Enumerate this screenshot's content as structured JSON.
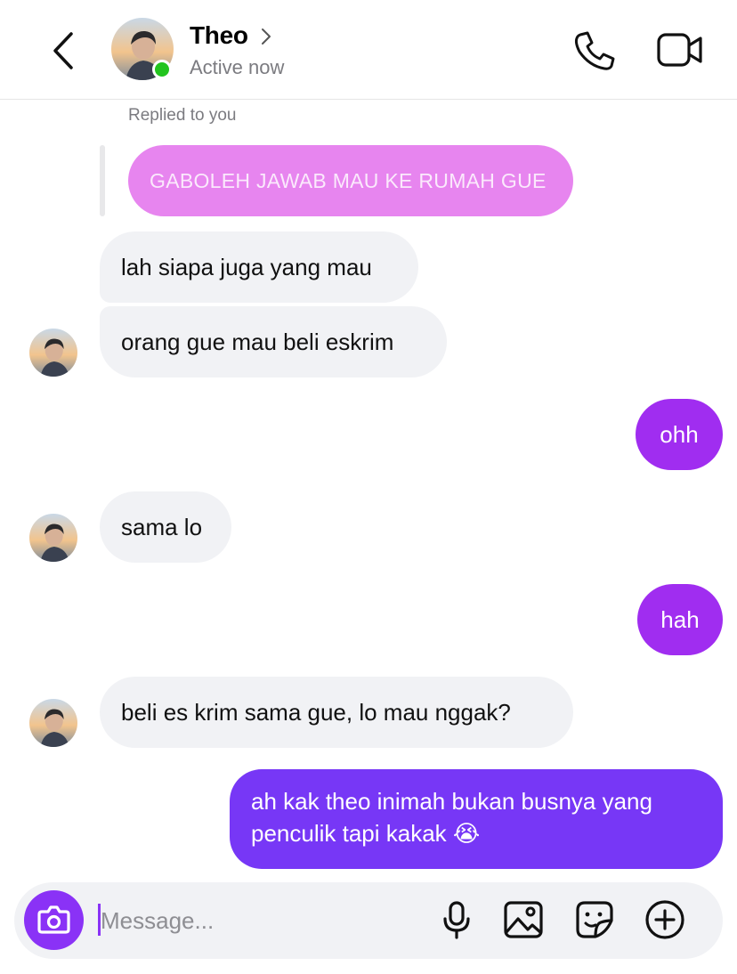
{
  "header": {
    "contact_name": "Theo",
    "status": "Active now"
  },
  "thread": {
    "replied_label": "Replied to you",
    "reply_quote": "GABOLEH JAWAB MAU KE RUMAH GUE",
    "messages": [
      {
        "from": "them",
        "text": "lah siapa juga yang mau"
      },
      {
        "from": "them",
        "text": "orang gue mau beli eskrim"
      },
      {
        "from": "me",
        "text": "ohh"
      },
      {
        "from": "them",
        "text": "sama lo"
      },
      {
        "from": "me",
        "text": "hah"
      },
      {
        "from": "them",
        "text": "beli es krim sama gue, lo mau nggak?"
      },
      {
        "from": "me",
        "text": "ah kak theo inimah bukan busnya yang penculik tapi kakak",
        "emoji": "😭"
      }
    ]
  },
  "composer": {
    "placeholder": "Message..."
  },
  "colors": {
    "accent_purple": "#8a32f6",
    "outgoing_bubble": "#a02df0",
    "outgoing_bubble_dark": "#7737f6",
    "reply_quote_bubble": "#e785ef",
    "incoming_bubble": "#f1f2f5",
    "online_dot": "#22c41e"
  },
  "icons": {
    "back": "chevron-left-icon",
    "call": "phone-icon",
    "video": "video-camera-icon",
    "camera": "camera-icon",
    "mic": "microphone-icon",
    "gallery": "image-icon",
    "sticker": "sticker-icon",
    "plus": "plus-circle-icon"
  }
}
